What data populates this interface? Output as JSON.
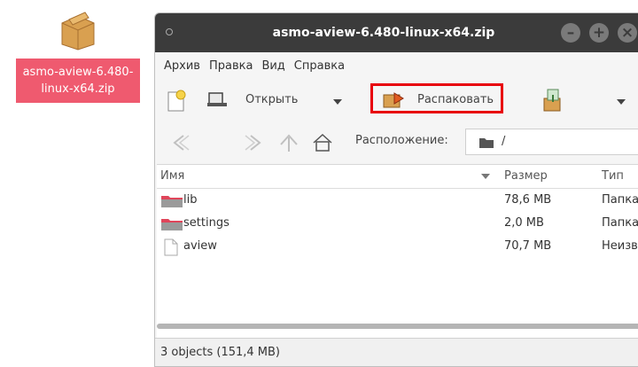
{
  "desktop_icon": {
    "label_line1": "asmo-aview-6.480-",
    "label_line2": "linux-x64.zip"
  },
  "window": {
    "title": "asmo-aview-6.480-linux-x64.zip",
    "min_glyph": "–",
    "max_glyph": "+",
    "close_glyph": "×"
  },
  "menu": {
    "items": [
      "Архив",
      "Правка",
      "Вид",
      "Справка"
    ]
  },
  "toolbar": {
    "open_label": "Открыть",
    "extract_label": "Распаковать"
  },
  "location": {
    "label": "Расположение:",
    "path": "/"
  },
  "list": {
    "columns": {
      "name": "Имя",
      "size": "Размер",
      "type": "Тип"
    },
    "rows": [
      {
        "name": "lib",
        "size": "78,6 MB",
        "type": "Папка",
        "icon": "folder-icon"
      },
      {
        "name": "settings",
        "size": "2,0 MB",
        "type": "Папка",
        "icon": "folder-icon"
      },
      {
        "name": "aview",
        "size": "70,7 MB",
        "type": "Неизв",
        "icon": "file-icon"
      }
    ]
  },
  "status": {
    "text": "3 objects (151,4 MB)"
  },
  "colors": {
    "titlebar": "#3b3b3b",
    "selection": "#ef5a6f",
    "highlight": "#e8000b"
  }
}
